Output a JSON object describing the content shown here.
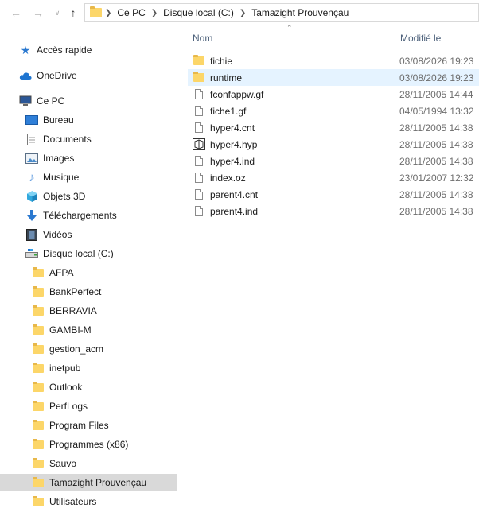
{
  "address_bar": {
    "crumbs": [
      "Ce PC",
      "Disque local (C:)",
      "Tamazight Prouvençau"
    ]
  },
  "sidebar": {
    "quick_access": "Accès rapide",
    "onedrive": "OneDrive",
    "this_pc": "Ce PC",
    "pc_items": [
      "Bureau",
      "Documents",
      "Images",
      "Musique",
      "Objets 3D",
      "Téléchargements",
      "Vidéos",
      "Disque local (C:)"
    ],
    "drive_folders": [
      "AFPA",
      "BankPerfect",
      "BERRAVIA",
      "GAMBI-M",
      "gestion_acm",
      "inetpub",
      "Outlook",
      "PerfLogs",
      "Program Files",
      "Programmes (x86)",
      "Sauvo",
      "Tamazight Prouvençau",
      "Utilisateurs"
    ],
    "selected": "Tamazight Prouvençau"
  },
  "content": {
    "columns": {
      "name": "Nom",
      "modified": "Modifié le"
    },
    "files": [
      {
        "name": "fichie",
        "date": "03/08/2026 19:23",
        "type": "folder"
      },
      {
        "name": "runtime",
        "date": "03/08/2026 19:23",
        "type": "folder"
      },
      {
        "name": "fconfappw.gf",
        "date": "28/11/2005 14:44",
        "type": "file"
      },
      {
        "name": "fiche1.gf",
        "date": "04/05/1994 13:32",
        "type": "file"
      },
      {
        "name": "hyper4.cnt",
        "date": "28/11/2005 14:38",
        "type": "file"
      },
      {
        "name": "hyper4.hyp",
        "date": "28/11/2005 14:38",
        "type": "hyp"
      },
      {
        "name": "hyper4.ind",
        "date": "28/11/2005 14:38",
        "type": "file"
      },
      {
        "name": "index.oz",
        "date": "23/01/2007 12:32",
        "type": "file"
      },
      {
        "name": "parent4.cnt",
        "date": "28/11/2005 14:38",
        "type": "file"
      },
      {
        "name": "parent4.ind",
        "date": "28/11/2005 14:38",
        "type": "file"
      }
    ],
    "hovered_row": "runtime"
  },
  "colors": {
    "folder": "#fcd669",
    "selected_bg": "#d9d9d9",
    "hover_bg": "#e5f3ff",
    "header_text": "#4c607a"
  }
}
